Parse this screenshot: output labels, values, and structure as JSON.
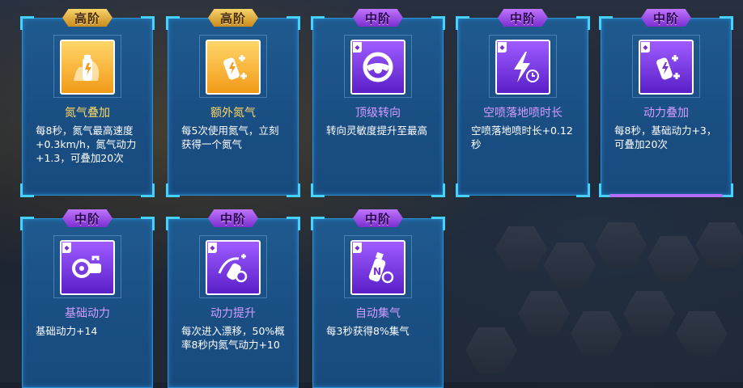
{
  "cards": [
    {
      "tier": "高阶",
      "title": "氮气叠加",
      "desc": "每8秒，氮气最高速度+0.3km/h，氮气动力+1.3，可叠加20次",
      "icon": "nitrous-bottle-icon",
      "rarity": "gold"
    },
    {
      "tier": "高阶",
      "title": "额外氮气",
      "desc": "每5次使用氮气，立刻获得一个氮气",
      "icon": "nitrous-plus-icon",
      "rarity": "gold"
    },
    {
      "tier": "中阶",
      "title": "顶级转向",
      "desc": "转向灵敏度提升至最高",
      "icon": "steering-wheel-icon",
      "rarity": "purple"
    },
    {
      "tier": "中阶",
      "title": "空喷落地喷时长",
      "desc": "空喷落地喷时长+0.12秒",
      "icon": "lightning-clock-icon",
      "rarity": "purple"
    },
    {
      "tier": "中阶",
      "title": "动力叠加",
      "desc": "每8秒，基础动力+3，可叠加20次",
      "icon": "power-canister-icon",
      "rarity": "purple"
    },
    {
      "tier": "中阶",
      "title": "基础动力",
      "desc": "基础动力+14",
      "icon": "turbo-engine-icon",
      "rarity": "purple"
    },
    {
      "tier": "中阶",
      "title": "动力提升",
      "desc": "每次进入漂移，50%概率8秒内氮气动力+10",
      "icon": "drift-boost-icon",
      "rarity": "purple"
    },
    {
      "tier": "中阶",
      "title": "自动集气",
      "desc": "每3秒获得8%集气",
      "icon": "nitro-bottle-timer-icon",
      "rarity": "purple"
    }
  ],
  "colors": {
    "gold": "#ffd861",
    "purple": "#d49bff",
    "card_bg": "#1a4f84",
    "glow": "#46d2ff"
  }
}
